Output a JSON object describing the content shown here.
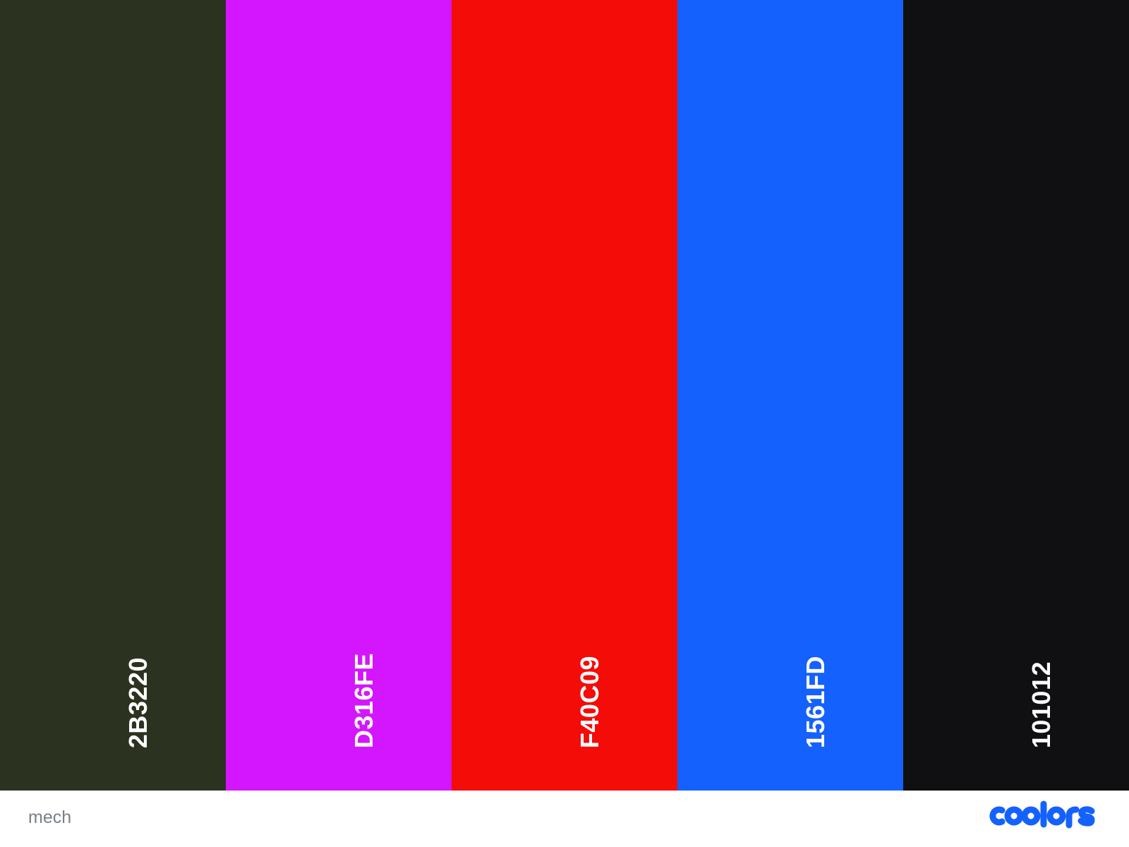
{
  "palette": {
    "swatches": [
      {
        "hex": "2B3220",
        "color": "#2B3220"
      },
      {
        "hex": "D316FE",
        "color": "#D316FE"
      },
      {
        "hex": "F40C09",
        "color": "#F40C09"
      },
      {
        "hex": "1561FD",
        "color": "#1561FD"
      },
      {
        "hex": "101012",
        "color": "#101012"
      }
    ]
  },
  "footer": {
    "palette_name": "mech",
    "brand_logo": "coolors",
    "brand_color": "#1561FD"
  }
}
